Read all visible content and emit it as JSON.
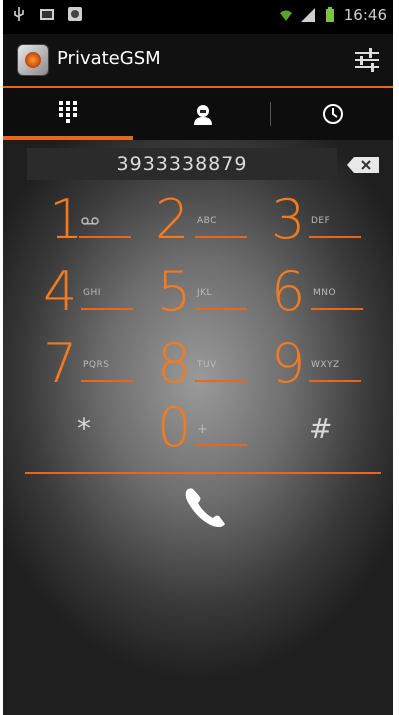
{
  "status_bar": {
    "time": "16:46"
  },
  "app": {
    "title": "PrivateGSM"
  },
  "tabs": [
    {
      "name": "dialpad",
      "icon": "dialpad-icon",
      "active": true
    },
    {
      "name": "contacts",
      "icon": "contact-icon",
      "active": false
    },
    {
      "name": "recents",
      "icon": "clock-icon",
      "active": false
    }
  ],
  "dialer": {
    "number": "3933338879",
    "keys": [
      {
        "digit": "1",
        "letters": "ω"
      },
      {
        "digit": "2",
        "letters": "ABC"
      },
      {
        "digit": "3",
        "letters": "DEF"
      },
      {
        "digit": "4",
        "letters": "GHI"
      },
      {
        "digit": "5",
        "letters": "JKL"
      },
      {
        "digit": "6",
        "letters": "MNO"
      },
      {
        "digit": "7",
        "letters": "PQRS"
      },
      {
        "digit": "8",
        "letters": "TUV"
      },
      {
        "digit": "9",
        "letters": "WXYZ"
      },
      {
        "digit": "0",
        "letters": "+"
      }
    ],
    "star": "*",
    "hash": "#"
  },
  "colors": {
    "accent": "#e8671d",
    "digit": "#f47a1f",
    "background": "#6e6e6e"
  }
}
